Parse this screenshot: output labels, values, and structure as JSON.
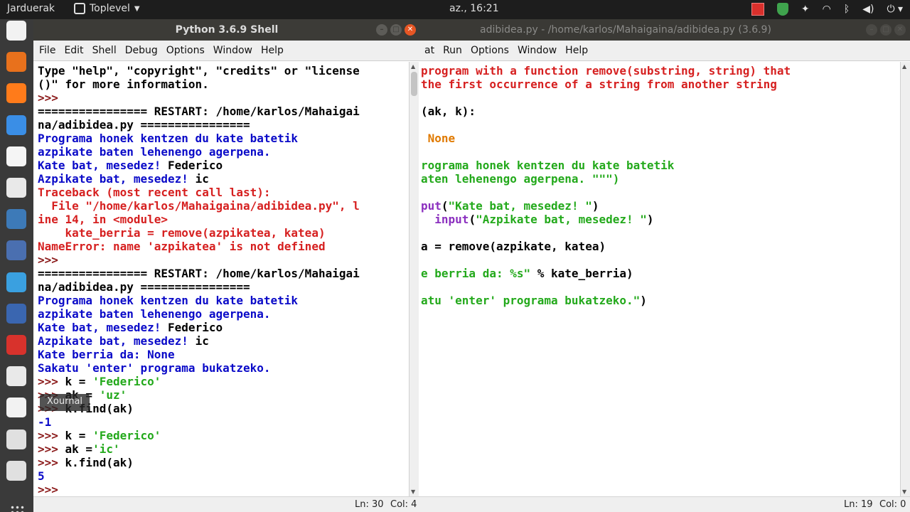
{
  "topbar": {
    "activities": "Jarduerak",
    "app_menu": "Toplevel",
    "clock": "az., 16:21"
  },
  "dock": {
    "tooltip": "Xournal",
    "apps": [
      {
        "name": "files",
        "color": "#f2f2f2"
      },
      {
        "name": "software-center",
        "color": "#e8711c"
      },
      {
        "name": "firefox",
        "color": "#ff7b1a"
      },
      {
        "name": "thunderbird",
        "color": "#3a8ee6"
      },
      {
        "name": "document",
        "color": "#f5f5f5"
      },
      {
        "name": "eog",
        "color": "#e9e9e9"
      },
      {
        "name": "python",
        "color": "#3d7ab8"
      },
      {
        "name": "maxima",
        "color": "#4a6fb0"
      },
      {
        "name": "sync",
        "color": "#3aa0e0"
      },
      {
        "name": "r",
        "color": "#3a66b0"
      },
      {
        "name": "chess",
        "color": "#d8322c"
      },
      {
        "name": "writer",
        "color": "#e9e9e9"
      },
      {
        "name": "xournal",
        "color": "#f2f2f2"
      },
      {
        "name": "editor",
        "color": "#e0e0e0"
      },
      {
        "name": "editor2",
        "color": "#e0e0e0"
      }
    ]
  },
  "shell": {
    "title": "Python 3.6.9 Shell",
    "menu": [
      "File",
      "Edit",
      "Shell",
      "Debug",
      "Options",
      "Window",
      "Help"
    ],
    "lines": [
      [
        {
          "t": "Type \"help\", \"copyright\", \"credits\" or \"license",
          "c": "k"
        }
      ],
      [
        {
          "t": "()\" for more information.",
          "c": "k"
        }
      ],
      [
        {
          "t": ">>> ",
          "c": "p"
        }
      ],
      [
        {
          "t": "================ RESTART: /home/karlos/Mahaigai",
          "c": "k"
        }
      ],
      [
        {
          "t": "na/adibidea.py ================",
          "c": "k"
        }
      ],
      [
        {
          "t": "Programa honek kentzen du kate batetik",
          "c": "b"
        }
      ],
      [
        {
          "t": "azpikate baten lehenengo agerpena.",
          "c": "b"
        }
      ],
      [
        {
          "t": "Kate bat, mesedez! ",
          "c": "b"
        },
        {
          "t": "Federico",
          "c": "k"
        }
      ],
      [
        {
          "t": "Azpikate bat, mesedez! ",
          "c": "b"
        },
        {
          "t": "ic",
          "c": "k"
        }
      ],
      [
        {
          "t": "Traceback (most recent call last):",
          "c": "r"
        }
      ],
      [
        {
          "t": "  File \"/home/karlos/Mahaigaina/adibidea.py\", l",
          "c": "r"
        }
      ],
      [
        {
          "t": "ine 14, in <module>",
          "c": "r"
        }
      ],
      [
        {
          "t": "    kate_berria = remove(azpikatea, katea)",
          "c": "r"
        }
      ],
      [
        {
          "t": "NameError: name 'azpikatea' is not defined",
          "c": "r"
        }
      ],
      [
        {
          "t": ">>> ",
          "c": "p"
        }
      ],
      [
        {
          "t": "================ RESTART: /home/karlos/Mahaigai",
          "c": "k"
        }
      ],
      [
        {
          "t": "na/adibidea.py ================",
          "c": "k"
        }
      ],
      [
        {
          "t": "Programa honek kentzen du kate batetik",
          "c": "b"
        }
      ],
      [
        {
          "t": "azpikate baten lehenengo agerpena.",
          "c": "b"
        }
      ],
      [
        {
          "t": "Kate bat, mesedez! ",
          "c": "b"
        },
        {
          "t": "Federico",
          "c": "k"
        }
      ],
      [
        {
          "t": "Azpikate bat, mesedez! ",
          "c": "b"
        },
        {
          "t": "ic",
          "c": "k"
        }
      ],
      [
        {
          "t": "Kate berria da: None",
          "c": "b"
        }
      ],
      [
        {
          "t": "Sakatu 'enter' programa bukatzeko.",
          "c": "b"
        }
      ],
      [
        {
          "t": ">>> ",
          "c": "p"
        },
        {
          "t": "k = ",
          "c": "k"
        },
        {
          "t": "'Federico'",
          "c": "g"
        }
      ],
      [
        {
          "t": ">>> ",
          "c": "p"
        },
        {
          "t": "ak = ",
          "c": "k"
        },
        {
          "t": "'uz'",
          "c": "g"
        }
      ],
      [
        {
          "t": ">>> ",
          "c": "p"
        },
        {
          "t": "k.find(ak)",
          "c": "k"
        }
      ],
      [
        {
          "t": "-1",
          "c": "b"
        }
      ],
      [
        {
          "t": ">>> ",
          "c": "p"
        },
        {
          "t": "k = ",
          "c": "k"
        },
        {
          "t": "'Federico'",
          "c": "g"
        }
      ],
      [
        {
          "t": ">>> ",
          "c": "p"
        },
        {
          "t": "ak =",
          "c": "k"
        },
        {
          "t": "'ic'",
          "c": "g"
        }
      ],
      [
        {
          "t": ">>> ",
          "c": "p"
        },
        {
          "t": "k.find(ak)",
          "c": "k"
        }
      ],
      [
        {
          "t": "5",
          "c": "b"
        }
      ],
      [
        {
          "t": ">>> ",
          "c": "p"
        }
      ]
    ],
    "status_line": "Ln: 30",
    "status_col": "Col: 4"
  },
  "editor": {
    "title": "adibidea.py - /home/karlos/Mahaigaina/adibidea.py (3.6.9)",
    "menu": [
      "at",
      "Run",
      "Options",
      "Window",
      "Help"
    ],
    "lines": [
      [
        {
          "t": "program with a function remove(substring, string) that",
          "c": "r"
        }
      ],
      [
        {
          "t": "the first occurrence of a string from another string",
          "c": "r"
        }
      ],
      [
        {
          "t": "",
          "c": "k"
        }
      ],
      [
        {
          "t": "(ak, k):",
          "c": "k"
        }
      ],
      [
        {
          "t": "",
          "c": "k"
        }
      ],
      [
        {
          "t": " None",
          "c": "o"
        }
      ],
      [
        {
          "t": "",
          "c": "k"
        }
      ],
      [
        {
          "t": "rograma honek kentzen du kate batetik",
          "c": "g"
        }
      ],
      [
        {
          "t": "aten lehenengo agerpena. \"\"\")",
          "c": "g"
        }
      ],
      [
        {
          "t": "",
          "c": "k"
        }
      ],
      [
        {
          "t": "put",
          "c": "pu"
        },
        {
          "t": "(",
          "c": "k"
        },
        {
          "t": "\"Kate bat, mesedez! \"",
          "c": "g"
        },
        {
          "t": ")",
          "c": "k"
        }
      ],
      [
        {
          "t": "  ",
          "c": "k"
        },
        {
          "t": "input",
          "c": "pu"
        },
        {
          "t": "(",
          "c": "k"
        },
        {
          "t": "\"Azpikate bat, mesedez! \"",
          "c": "g"
        },
        {
          "t": ")",
          "c": "k"
        }
      ],
      [
        {
          "t": "",
          "c": "k"
        }
      ],
      [
        {
          "t": "a = remove(azpikate, katea)",
          "c": "k"
        }
      ],
      [
        {
          "t": "",
          "c": "k"
        }
      ],
      [
        {
          "t": "e berria da: %s\"",
          "c": "g"
        },
        {
          "t": " % kate_berria)",
          "c": "k"
        }
      ],
      [
        {
          "t": "",
          "c": "k"
        }
      ],
      [
        {
          "t": "atu 'enter' programa bukatzeko.\"",
          "c": "g"
        },
        {
          "t": ")",
          "c": "k"
        }
      ]
    ],
    "status_line": "Ln: 19",
    "status_col": "Col: 0"
  }
}
